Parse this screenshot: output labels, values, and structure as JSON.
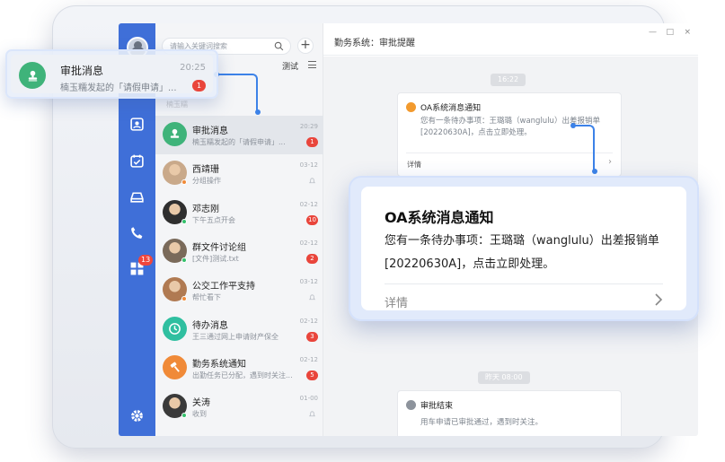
{
  "colors": {
    "accent": "#3f6fd8",
    "connector": "#3c82e8",
    "badge": "#e9453b",
    "approval_green": "#3fb37a",
    "orange": "#f08a38",
    "teal": "#2fbfa0"
  },
  "search": {
    "placeholder": "请输入关键词搜索"
  },
  "list_header": {
    "tab_label": "测试"
  },
  "sidebar": {
    "icons": [
      "contacts-icon",
      "calendar-icon",
      "cloud-drive-icon",
      "phone-icon",
      "apps-icon",
      "settings-icon"
    ],
    "apps_badge": "13"
  },
  "conversations": [
    {
      "name": "审批消息",
      "preview": "楠玉糯发起的「请假申请」...",
      "time": "20:29",
      "badge": "1",
      "avatar_icon": "stamp-icon",
      "avatar_color": "#3fb37a",
      "active": true
    },
    {
      "name": "西靖珊",
      "preview": "分组操作",
      "time": "03-12",
      "badge": "",
      "avatar_icon": "user-photo"
    },
    {
      "name": "邓志刚",
      "preview": "下午五点开会",
      "time": "02-12",
      "badge": "10",
      "avatar_icon": "user-photo"
    },
    {
      "name": "群文件讨论组",
      "preview": "[文件]测试.txt",
      "time": "02-12",
      "badge": "2",
      "avatar_icon": "group-photo"
    },
    {
      "name": "公交工作平支持",
      "preview": "帮忙看下",
      "time": "03-12",
      "badge": "",
      "avatar_icon": "user-photo"
    },
    {
      "name": "待办消息",
      "preview": "王三通过网上申请财产保全",
      "time": "02-12",
      "badge": "3",
      "avatar_icon": "clock-icon",
      "avatar_color": "#2fbfa0"
    },
    {
      "name": "勤务系统通知",
      "preview": "出勤任务已分配，遇到时关注...",
      "time": "02-12",
      "badge": "5",
      "avatar_icon": "hammer-icon",
      "avatar_color": "#f08a38"
    },
    {
      "name": "关涛",
      "preview": "收到",
      "time": "01-00",
      "badge": "",
      "avatar_icon": "user-photo"
    }
  ],
  "chat": {
    "title": "勤务系统：审批提醒",
    "window_controls": [
      "—",
      "□",
      "×"
    ],
    "time_1": "16:22",
    "time_2": "昨天 08:00",
    "card_1": {
      "title": "OA系统消息通知",
      "body": "您有一条待办事项：王璐璐（wanglulu）出差报销单[20220630A]，点击立即处理。",
      "detail": "详情"
    },
    "card_2": {
      "title": "审批结束",
      "body": "用车申请已审批通过，遇到时关注。"
    }
  },
  "popup_small": {
    "name": "审批消息",
    "preview": "楠玉糯发起的「请假申请」...",
    "time": "20:25",
    "badge": "1"
  },
  "popup_big": {
    "title": "OA系统消息通知",
    "body": "您有一条待办事项：王璐璐（wanglulu）出差报销单[20220630A]，点击立即处理。",
    "detail": "详情"
  }
}
